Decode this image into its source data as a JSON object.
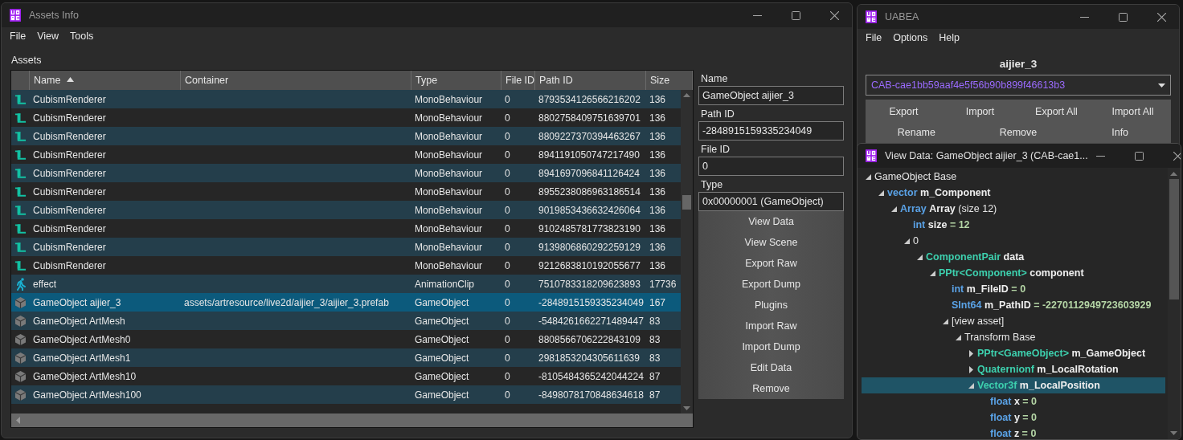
{
  "assets_window": {
    "title": "Assets Info",
    "menu": [
      "File",
      "View",
      "Tools"
    ],
    "section_label": "Assets",
    "table": {
      "columns": [
        "Name",
        "Container",
        "Type",
        "File ID",
        "Path ID",
        "Size"
      ],
      "rows": [
        {
          "kind": "script",
          "name": "CubismRenderer",
          "container": "",
          "type": "MonoBehaviour",
          "file_id": "0",
          "path_id": "8793534126566216202",
          "size": "136",
          "selected": false
        },
        {
          "kind": "script",
          "name": "CubismRenderer",
          "container": "",
          "type": "MonoBehaviour",
          "file_id": "0",
          "path_id": "8802758409751639701",
          "size": "136",
          "selected": false
        },
        {
          "kind": "script",
          "name": "CubismRenderer",
          "container": "",
          "type": "MonoBehaviour",
          "file_id": "0",
          "path_id": "8809227370394463267",
          "size": "136",
          "selected": false
        },
        {
          "kind": "script",
          "name": "CubismRenderer",
          "container": "",
          "type": "MonoBehaviour",
          "file_id": "0",
          "path_id": "8941191050747217490",
          "size": "136",
          "selected": false
        },
        {
          "kind": "script",
          "name": "CubismRenderer",
          "container": "",
          "type": "MonoBehaviour",
          "file_id": "0",
          "path_id": "8941697096841126424",
          "size": "136",
          "selected": false
        },
        {
          "kind": "script",
          "name": "CubismRenderer",
          "container": "",
          "type": "MonoBehaviour",
          "file_id": "0",
          "path_id": "8955238086963186514",
          "size": "136",
          "selected": false
        },
        {
          "kind": "script",
          "name": "CubismRenderer",
          "container": "",
          "type": "MonoBehaviour",
          "file_id": "0",
          "path_id": "9019853436632426064",
          "size": "136",
          "selected": false
        },
        {
          "kind": "script",
          "name": "CubismRenderer",
          "container": "",
          "type": "MonoBehaviour",
          "file_id": "0",
          "path_id": "9102485781773823190",
          "size": "136",
          "selected": false
        },
        {
          "kind": "script",
          "name": "CubismRenderer",
          "container": "",
          "type": "MonoBehaviour",
          "file_id": "0",
          "path_id": "9139806860292259129",
          "size": "136",
          "selected": false
        },
        {
          "kind": "script",
          "name": "CubismRenderer",
          "container": "",
          "type": "MonoBehaviour",
          "file_id": "0",
          "path_id": "9212683810192055677",
          "size": "136",
          "selected": false
        },
        {
          "kind": "animation",
          "name": "effect",
          "container": "",
          "type": "AnimationClip",
          "file_id": "0",
          "path_id": "7510783318209623893",
          "size": "17736",
          "selected": false
        },
        {
          "kind": "gameobject",
          "name": "GameObject aijier_3",
          "container": "assets/artresource/live2d/aijier_3/aijier_3.prefab",
          "type": "GameObject",
          "file_id": "0",
          "path_id": "-2848915159335234049",
          "size": "167",
          "selected": true
        },
        {
          "kind": "gameobject",
          "name": "GameObject ArtMesh",
          "container": "",
          "type": "GameObject",
          "file_id": "0",
          "path_id": "-5484261662271489447",
          "size": "83",
          "selected": false
        },
        {
          "kind": "gameobject",
          "name": "GameObject ArtMesh0",
          "container": "",
          "type": "GameObject",
          "file_id": "0",
          "path_id": "8808566706222843109",
          "size": "83",
          "selected": false
        },
        {
          "kind": "gameobject",
          "name": "GameObject ArtMesh1",
          "container": "",
          "type": "GameObject",
          "file_id": "0",
          "path_id": "2981853204305611639",
          "size": "83",
          "selected": false
        },
        {
          "kind": "gameobject",
          "name": "GameObject ArtMesh10",
          "container": "",
          "type": "GameObject",
          "file_id": "0",
          "path_id": "-8105484365242044224",
          "size": "87",
          "selected": false
        },
        {
          "kind": "gameobject",
          "name": "GameObject ArtMesh100",
          "container": "",
          "type": "GameObject",
          "file_id": "0",
          "path_id": "-8498078170848634618",
          "size": "87",
          "selected": false
        }
      ]
    },
    "fields": [
      {
        "label": "Name",
        "value": "GameObject aijier_3"
      },
      {
        "label": "Path ID",
        "value": "-2848915159335234049"
      },
      {
        "label": "File ID",
        "value": "0"
      },
      {
        "label": "Type",
        "value": "0x00000001 (GameObject)"
      }
    ],
    "buttons": [
      "View Data",
      "View Scene",
      "Export Raw",
      "Export Dump",
      "Plugins",
      "Import Raw",
      "Import Dump",
      "Edit Data",
      "Remove"
    ]
  },
  "uabea_window": {
    "title": "UABEA",
    "menu": [
      "File",
      "Options",
      "Help"
    ],
    "bundle_name": "aijier_3",
    "file_dropdown": "CAB-cae1bb59aaf4e5f56b90b899f46613b3",
    "buttons_row1": [
      "Export",
      "Import",
      "Export All",
      "Import All"
    ],
    "buttons_row2": [
      "Rename",
      "Remove",
      "Info"
    ]
  },
  "view_data_window": {
    "title": "View Data: GameObject aijier_3 (CAB-cae1...",
    "tree": [
      {
        "label": "GameObject Base",
        "expanded": true,
        "selected": false,
        "children": [
          {
            "type": "vector",
            "color": "#5aa2e6",
            "name": "m_Component",
            "expanded": true,
            "selected": false,
            "children": [
              {
                "type": "Array",
                "color": "#5aa2e6",
                "name": "Array",
                "detail": "(size 12)",
                "expanded": true,
                "selected": false,
                "children": [
                  {
                    "type": "int",
                    "color": "#5aa2e6",
                    "name": "size",
                    "value": "= 12",
                    "selected": false
                  },
                  {
                    "label": "0",
                    "expanded": true,
                    "selected": false,
                    "children": [
                      {
                        "type": "ComponentPair",
                        "color": "#3dd0ae",
                        "name": "data",
                        "expanded": true,
                        "selected": false,
                        "children": [
                          {
                            "type": "PPtr<Component>",
                            "color": "#3dd0ae",
                            "name": "component",
                            "expanded": true,
                            "selected": false,
                            "children": [
                              {
                                "type": "int",
                                "color": "#5aa2e6",
                                "name": "m_FileID",
                                "value": "= 0",
                                "selected": false
                              },
                              {
                                "type": "SInt64",
                                "color": "#5aa2e6",
                                "name": "m_PathID",
                                "value": "= -2270112949723603929",
                                "selected": false
                              },
                              {
                                "label": "[view asset]",
                                "expanded": true,
                                "selected": false,
                                "children": [
                                  {
                                    "label": "Transform Base",
                                    "expanded": true,
                                    "selected": false,
                                    "children": [
                                      {
                                        "type": "PPtr<GameObject>",
                                        "color": "#3dd0ae",
                                        "name": "m_GameObject",
                                        "expanded": false,
                                        "selected": false
                                      },
                                      {
                                        "type": "Quaternionf",
                                        "color": "#3dd0ae",
                                        "name": "m_LocalRotation",
                                        "expanded": false,
                                        "selected": false
                                      },
                                      {
                                        "type": "Vector3f",
                                        "color": "#3dd0ae",
                                        "name": "m_LocalPosition",
                                        "expanded": true,
                                        "selected": true,
                                        "children": [
                                          {
                                            "type": "float",
                                            "color": "#5aa2e6",
                                            "name": "x",
                                            "value": "= 0",
                                            "selected": false
                                          },
                                          {
                                            "type": "float",
                                            "color": "#5aa2e6",
                                            "name": "y",
                                            "value": "= 0",
                                            "selected": false
                                          },
                                          {
                                            "type": "float",
                                            "color": "#5aa2e6",
                                            "name": "z",
                                            "value": "= 0",
                                            "selected": false
                                          }
                                        ]
                                      }
                                    ]
                                  }
                                ]
                              }
                            ]
                          }
                        ]
                      }
                    ]
                  }
                ]
              }
            ]
          }
        ]
      }
    ]
  }
}
